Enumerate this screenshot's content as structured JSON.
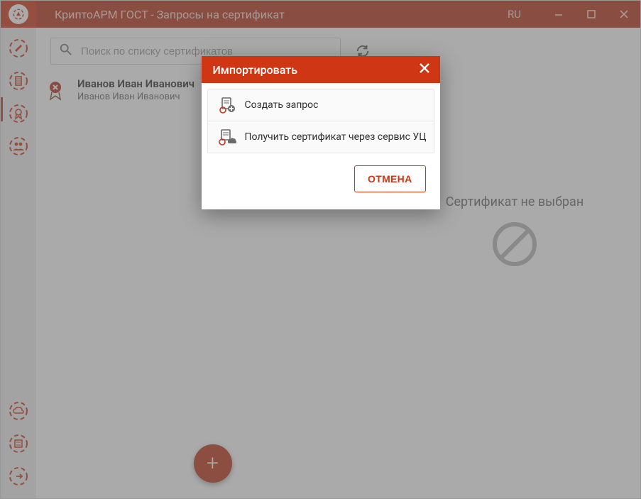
{
  "titlebar": {
    "title": "КриптоАРМ ГОСТ - Запросы на сертификат",
    "lang": "RU"
  },
  "search": {
    "placeholder": "Поиск по списку сертификатов"
  },
  "certs": [
    {
      "name": "Иванов Иван Иванович",
      "sub": "Иванов Иван Иванович"
    }
  ],
  "right_panel": {
    "empty_message": "Сертификат не выбран"
  },
  "dialog": {
    "title": "Импортировать",
    "option_create": "Создать запрос",
    "option_service": "Получить сертификат через сервис УЦ",
    "cancel": "ОТМЕНА"
  },
  "colors": {
    "accent": "#cf3614"
  }
}
